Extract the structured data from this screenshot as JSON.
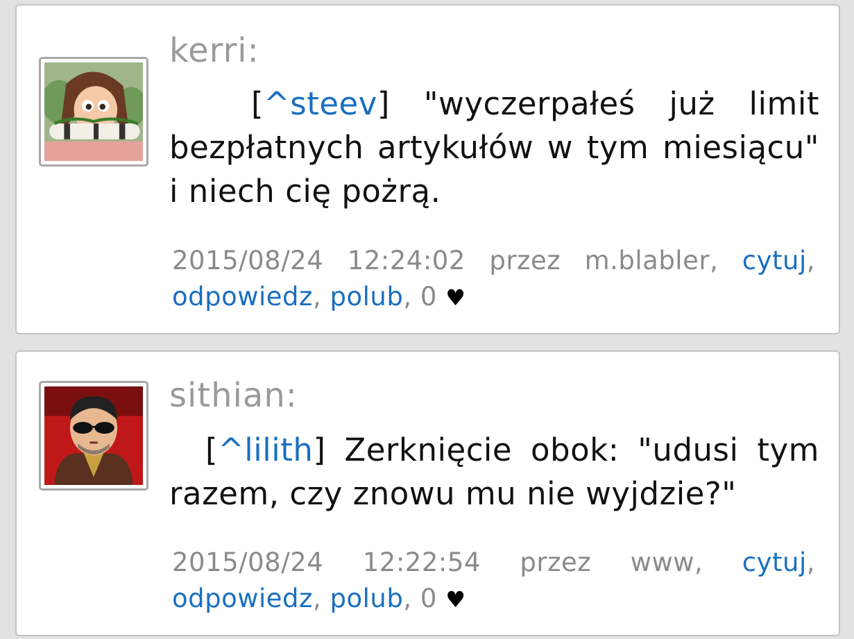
{
  "comments": [
    {
      "username": "kerri:",
      "mention": "^steev",
      "text": "\"wyczerpałeś już limit bezpłatnych artykułów w tym miesiącu\" i niech cię pożrą.",
      "date": "2015/08/24",
      "time": "12:24:02",
      "by_label": "przez",
      "author": "m.blabler",
      "quote_label": "cytuj",
      "reply_label": "odpowiedz",
      "like_label": "polub",
      "likes": "0",
      "heart_icon": "♥",
      "avatar_icon": "girl-avatar-icon"
    },
    {
      "username": "sithian:",
      "mention": "^lilith",
      "text": "Zerknięcie obok: \"udusi tym razem, czy znowu mu nie wyjdzie?\"",
      "date": "2015/08/24",
      "time": "12:22:54",
      "by_label": "przez",
      "author": "www,",
      "quote_label": "cytuj",
      "reply_label": "odpowiedz",
      "like_label": "polub",
      "likes": "0",
      "heart_icon": "♥",
      "avatar_icon": "man-sunglasses-avatar-icon"
    }
  ],
  "colors": {
    "link": "#1a6fc0",
    "username": "#9a9a9a",
    "meta": "#8a8a8a",
    "background": "#e2e2e2"
  }
}
